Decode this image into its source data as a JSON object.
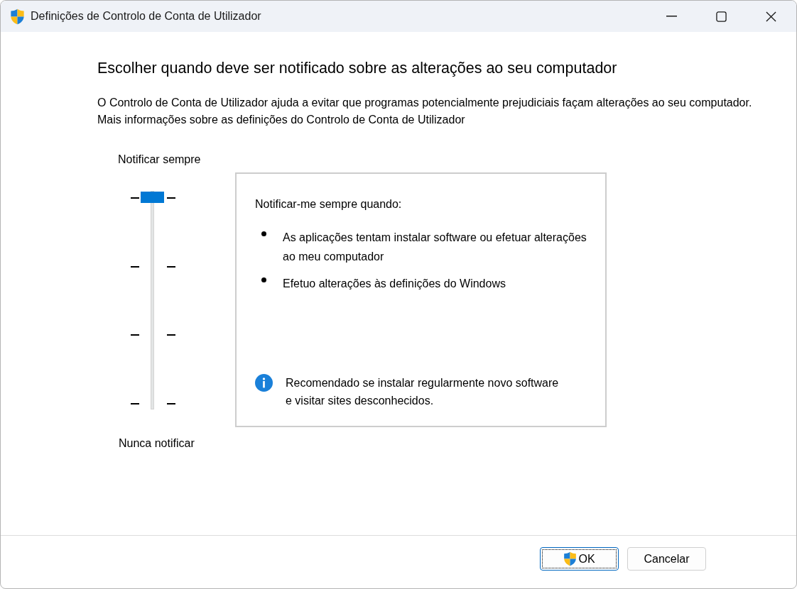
{
  "window": {
    "title": "Definições de Controlo de Conta de Utilizador"
  },
  "heading": "Escolher quando deve ser notificado sobre as alterações ao seu computador",
  "description": "O Controlo de Conta de Utilizador ajuda a evitar que programas potencialmente prejudiciais façam alterações ao seu computador.",
  "more_info_link": "Mais informações sobre as definições do Controlo de Conta de Utilizador",
  "slider": {
    "top_label": "Notificar sempre",
    "bottom_label": "Nunca notificar",
    "level": 1
  },
  "info_panel": {
    "heading": "Notificar-me sempre quando:",
    "items": [
      "As aplicações tentam instalar software ou efetuar alterações ao meu computador",
      "Efetuo alterações às definições do Windows"
    ],
    "recommendation": "Recomendado se instalar regularmente novo software\ne visitar sites desconhecidos."
  },
  "buttons": [
    {
      "label": "OK",
      "kind": "elevated",
      "focused": true
    },
    {
      "label": "Cancelar",
      "kind": "plain",
      "focused": false
    }
  ]
}
